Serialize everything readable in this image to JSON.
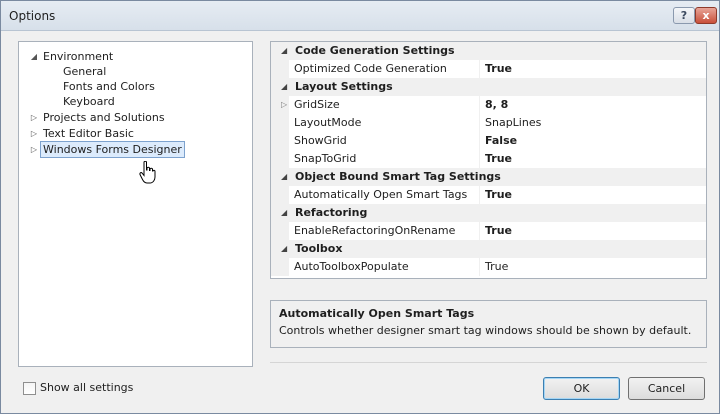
{
  "window": {
    "title": "Options",
    "help_label": "?",
    "close_label": "x"
  },
  "tree": {
    "items": [
      {
        "label": "Environment",
        "arrow": "◢",
        "indent": 1
      },
      {
        "label": "General",
        "arrow": "",
        "indent": 2
      },
      {
        "label": "Fonts and Colors",
        "arrow": "",
        "indent": 2
      },
      {
        "label": "Keyboard",
        "arrow": "",
        "indent": 2
      },
      {
        "label": "Projects and Solutions",
        "arrow": "▷",
        "indent": 1
      },
      {
        "label": "Text Editor Basic",
        "arrow": "▷",
        "indent": 1
      },
      {
        "label": "Windows Forms Designer",
        "arrow": "▷",
        "indent": 1,
        "selected": true
      }
    ]
  },
  "property_grid": {
    "rows": [
      {
        "type": "category",
        "label": "Code Generation Settings"
      },
      {
        "type": "prop",
        "name": "Optimized Code Generation",
        "value": "True",
        "bold": true
      },
      {
        "type": "category",
        "label": "Layout Settings"
      },
      {
        "type": "prop",
        "name": "GridSize",
        "value": "8, 8",
        "bold": true,
        "expandable": true
      },
      {
        "type": "prop",
        "name": "LayoutMode",
        "value": "SnapLines",
        "bold": false
      },
      {
        "type": "prop",
        "name": "ShowGrid",
        "value": "False",
        "bold": true
      },
      {
        "type": "prop",
        "name": "SnapToGrid",
        "value": "True",
        "bold": true
      },
      {
        "type": "category",
        "label": "Object Bound Smart Tag Settings"
      },
      {
        "type": "prop",
        "name": "Automatically Open Smart Tags",
        "value": "True",
        "bold": true
      },
      {
        "type": "category",
        "label": "Refactoring"
      },
      {
        "type": "prop",
        "name": "EnableRefactoringOnRename",
        "value": "True",
        "bold": true
      },
      {
        "type": "category",
        "label": "Toolbox"
      },
      {
        "type": "prop",
        "name": "AutoToolboxPopulate",
        "value": "True",
        "bold": false
      }
    ]
  },
  "description": {
    "title": "Automatically Open Smart Tags",
    "text": "Controls whether designer smart tag windows should be shown by default."
  },
  "footer": {
    "show_all_label": "Show all settings",
    "ok_label": "OK",
    "cancel_label": "Cancel"
  }
}
